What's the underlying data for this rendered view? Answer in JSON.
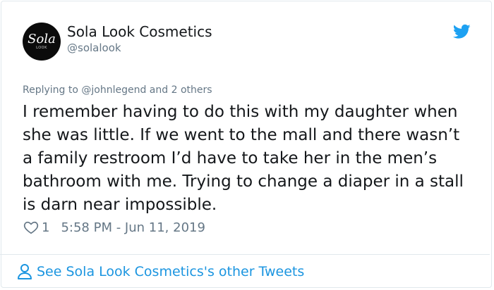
{
  "author": {
    "name": "Sola Look Cosmetics",
    "handle": "@solalook",
    "avatar_logo": "Sola",
    "avatar_sublogo": "LOOK"
  },
  "tweet": {
    "replying_prefix": "Replying to ",
    "replying_mention": "@johnlegend",
    "replying_suffix": " and 2 others",
    "text": "I remember having to do this with my daughter when she was little. If we went to the mall and there wasn’t a family restroom I’d have to take her in the men’s bathroom with me. Trying to change a diaper in a stall is darn near impossible.",
    "like_count": "1",
    "timestamp": "5:58 PM - Jun 11, 2019"
  },
  "footer": {
    "link_label": "See Sola Look Cosmetics's other Tweets"
  },
  "icons": {
    "brand": "twitter-bird-icon",
    "like": "heart-icon",
    "profile": "person-icon"
  },
  "colors": {
    "twitter_blue": "#1da1f2",
    "link_blue": "#1b95e0",
    "secondary_text": "#657786",
    "border": "#e1e8ed"
  }
}
